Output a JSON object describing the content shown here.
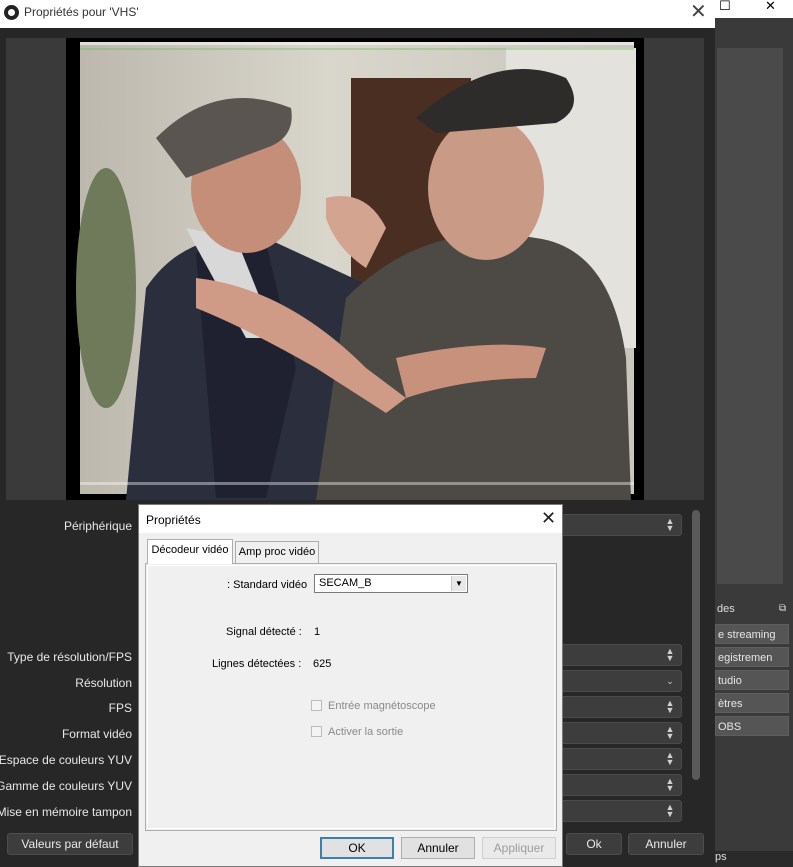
{
  "window": {
    "title": "Propriétés pour 'VHS'"
  },
  "obs_main": {
    "controls_header": "des",
    "buttons": [
      "e streaming",
      "egistremen",
      "tudio",
      "ètres",
      "OBS"
    ],
    "footer": "ps"
  },
  "form": {
    "fields": [
      {
        "label": "Périphérique"
      },
      {
        "label": "Type de résolution/FPS"
      },
      {
        "label": "Résolution"
      },
      {
        "label": "FPS"
      },
      {
        "label": "Format vidéo"
      },
      {
        "label": "Espace de couleurs YUV"
      },
      {
        "label": "Gamme de couleurs YUV"
      },
      {
        "label": "Mise en mémoire tampon"
      }
    ]
  },
  "buttons": {
    "defaults": "Valeurs par défaut",
    "ok": "Ok",
    "cancel": "Annuler"
  },
  "dialog": {
    "title": "Propriétés",
    "tabs": [
      "Décodeur vidéo",
      "Amp proc vidéo"
    ],
    "active_tab": 0,
    "video_standard_label": ": Standard vidéo",
    "video_standard_value": "SECAM_B",
    "signal_label": "Signal détecté :",
    "signal_value": "1",
    "lines_label": "Lignes détectées :",
    "lines_value": "625",
    "checkbox_vcr": "Entrée magnétoscope",
    "checkbox_output": "Activer la sortie",
    "ok": "OK",
    "cancel": "Annuler",
    "apply": "Appliquer"
  }
}
